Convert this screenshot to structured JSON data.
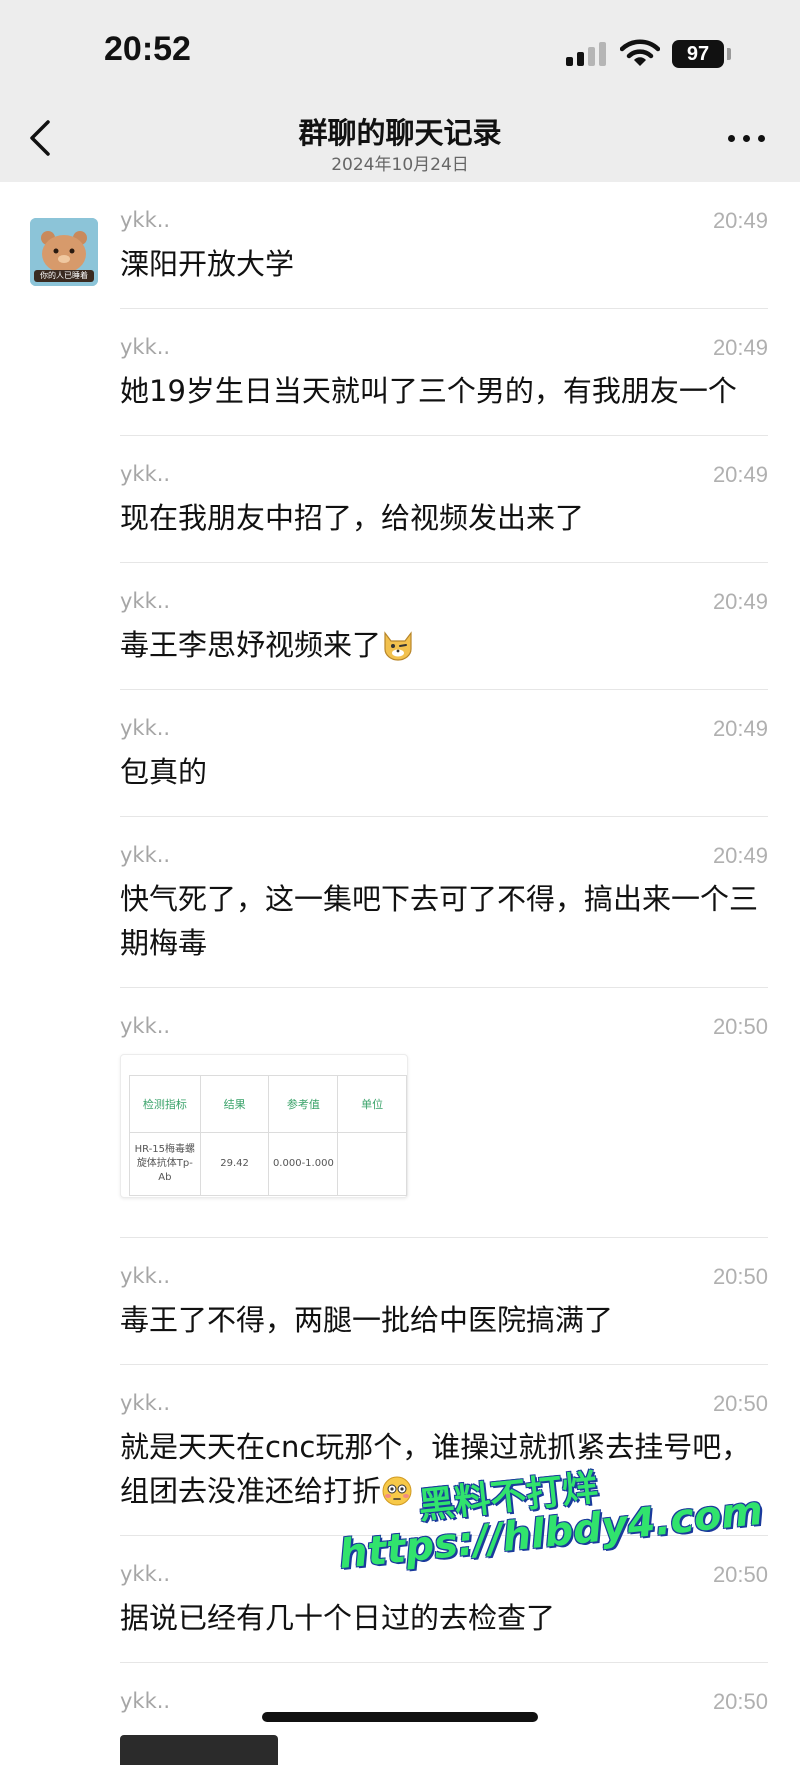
{
  "status_bar": {
    "time": "20:52",
    "battery": "97"
  },
  "nav": {
    "title": "群聊的聊天记录",
    "subtitle": "2024年10月24日"
  },
  "avatar_caption": "你的人已睡着",
  "messages": [
    {
      "sender": "ykk..",
      "time": "20:49",
      "text": "溧阳开放大学"
    },
    {
      "sender": "ykk..",
      "time": "20:49",
      "text": "她19岁生日当天就叫了三个男的，有我朋友一个"
    },
    {
      "sender": "ykk..",
      "time": "20:49",
      "text": "现在我朋友中招了，给视频发出来了"
    },
    {
      "sender": "ykk..",
      "time": "20:49",
      "text": "毒王李思妤视频来了"
    },
    {
      "sender": "ykk..",
      "time": "20:49",
      "text": "包真的"
    },
    {
      "sender": "ykk..",
      "time": "20:49",
      "text": "快气死了，这一集吧下去可了不得，搞出来一个三期梅毒"
    },
    {
      "sender": "ykk..",
      "time": "20:50"
    },
    {
      "sender": "ykk..",
      "time": "20:50",
      "text": "毒王了不得，两腿一批给中医院搞满了"
    },
    {
      "sender": "ykk..",
      "time": "20:50",
      "text": "就是天天在cnc玩那个，谁操过就抓紧去挂号吧，组团去没准还给打折"
    },
    {
      "sender": "ykk..",
      "time": "20:50",
      "text": "据说已经有几十个日过的去检查了"
    },
    {
      "sender": "ykk..",
      "time": "20:50"
    }
  ],
  "lab_report": {
    "headers": [
      "检测指标",
      "结果",
      "参考值",
      "单位"
    ],
    "row": [
      "HR-15梅毒螺旋体抗体Tp-Ab",
      "29.42",
      "0.000-1.000",
      ""
    ]
  },
  "watermark": {
    "line1": "黑料不打烊",
    "line2": "https://hlbdy4.com"
  }
}
